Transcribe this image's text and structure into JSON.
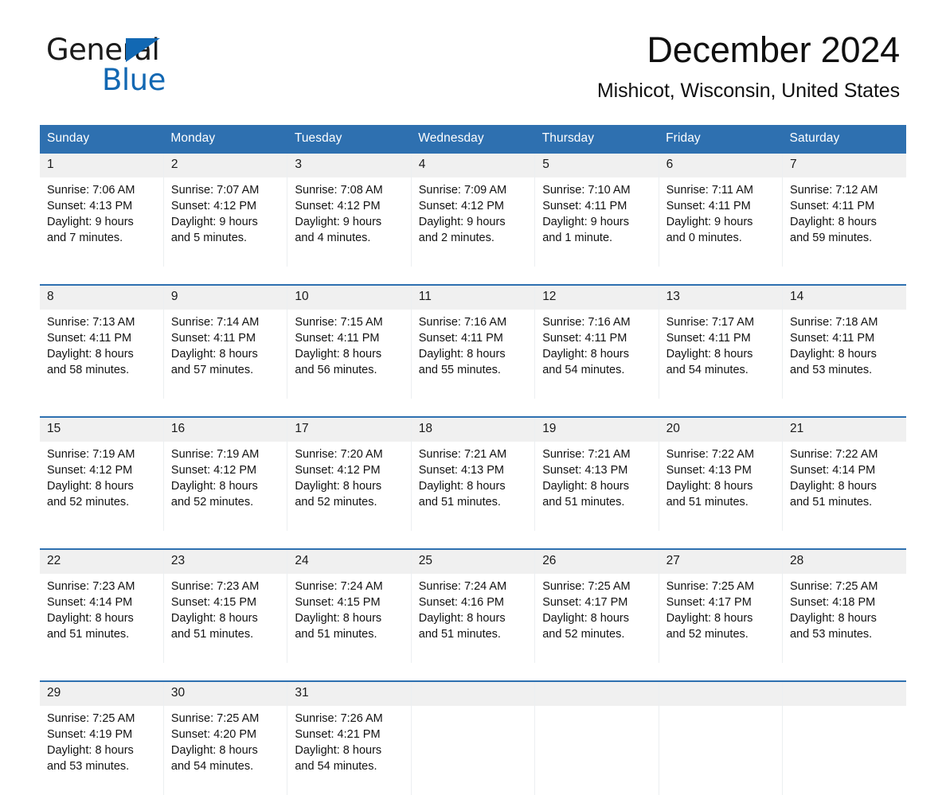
{
  "brand": {
    "name_part1": "General",
    "name_part2": "Blue",
    "accent_color": "#1268b3"
  },
  "header": {
    "title": "December 2024",
    "subtitle": "Mishicot, Wisconsin, United States"
  },
  "theme": {
    "header_blue": "#2e70b0",
    "daynum_band": "#f0f0f0",
    "text": "#1a1a1a"
  },
  "weekday_headers": [
    "Sunday",
    "Monday",
    "Tuesday",
    "Wednesday",
    "Thursday",
    "Friday",
    "Saturday"
  ],
  "labels": {
    "sunrise_prefix": "Sunrise:",
    "sunset_prefix": "Sunset:",
    "daylight_prefix": "Daylight:"
  },
  "weeks": [
    [
      {
        "day": "1",
        "sunrise": "Sunrise: 7:06 AM",
        "sunset": "Sunset: 4:13 PM",
        "daylight_line1": "Daylight: 9 hours",
        "daylight_line2": "and 7 minutes."
      },
      {
        "day": "2",
        "sunrise": "Sunrise: 7:07 AM",
        "sunset": "Sunset: 4:12 PM",
        "daylight_line1": "Daylight: 9 hours",
        "daylight_line2": "and 5 minutes."
      },
      {
        "day": "3",
        "sunrise": "Sunrise: 7:08 AM",
        "sunset": "Sunset: 4:12 PM",
        "daylight_line1": "Daylight: 9 hours",
        "daylight_line2": "and 4 minutes."
      },
      {
        "day": "4",
        "sunrise": "Sunrise: 7:09 AM",
        "sunset": "Sunset: 4:12 PM",
        "daylight_line1": "Daylight: 9 hours",
        "daylight_line2": "and 2 minutes."
      },
      {
        "day": "5",
        "sunrise": "Sunrise: 7:10 AM",
        "sunset": "Sunset: 4:11 PM",
        "daylight_line1": "Daylight: 9 hours",
        "daylight_line2": "and 1 minute."
      },
      {
        "day": "6",
        "sunrise": "Sunrise: 7:11 AM",
        "sunset": "Sunset: 4:11 PM",
        "daylight_line1": "Daylight: 9 hours",
        "daylight_line2": "and 0 minutes."
      },
      {
        "day": "7",
        "sunrise": "Sunrise: 7:12 AM",
        "sunset": "Sunset: 4:11 PM",
        "daylight_line1": "Daylight: 8 hours",
        "daylight_line2": "and 59 minutes."
      }
    ],
    [
      {
        "day": "8",
        "sunrise": "Sunrise: 7:13 AM",
        "sunset": "Sunset: 4:11 PM",
        "daylight_line1": "Daylight: 8 hours",
        "daylight_line2": "and 58 minutes."
      },
      {
        "day": "9",
        "sunrise": "Sunrise: 7:14 AM",
        "sunset": "Sunset: 4:11 PM",
        "daylight_line1": "Daylight: 8 hours",
        "daylight_line2": "and 57 minutes."
      },
      {
        "day": "10",
        "sunrise": "Sunrise: 7:15 AM",
        "sunset": "Sunset: 4:11 PM",
        "daylight_line1": "Daylight: 8 hours",
        "daylight_line2": "and 56 minutes."
      },
      {
        "day": "11",
        "sunrise": "Sunrise: 7:16 AM",
        "sunset": "Sunset: 4:11 PM",
        "daylight_line1": "Daylight: 8 hours",
        "daylight_line2": "and 55 minutes."
      },
      {
        "day": "12",
        "sunrise": "Sunrise: 7:16 AM",
        "sunset": "Sunset: 4:11 PM",
        "daylight_line1": "Daylight: 8 hours",
        "daylight_line2": "and 54 minutes."
      },
      {
        "day": "13",
        "sunrise": "Sunrise: 7:17 AM",
        "sunset": "Sunset: 4:11 PM",
        "daylight_line1": "Daylight: 8 hours",
        "daylight_line2": "and 54 minutes."
      },
      {
        "day": "14",
        "sunrise": "Sunrise: 7:18 AM",
        "sunset": "Sunset: 4:11 PM",
        "daylight_line1": "Daylight: 8 hours",
        "daylight_line2": "and 53 minutes."
      }
    ],
    [
      {
        "day": "15",
        "sunrise": "Sunrise: 7:19 AM",
        "sunset": "Sunset: 4:12 PM",
        "daylight_line1": "Daylight: 8 hours",
        "daylight_line2": "and 52 minutes."
      },
      {
        "day": "16",
        "sunrise": "Sunrise: 7:19 AM",
        "sunset": "Sunset: 4:12 PM",
        "daylight_line1": "Daylight: 8 hours",
        "daylight_line2": "and 52 minutes."
      },
      {
        "day": "17",
        "sunrise": "Sunrise: 7:20 AM",
        "sunset": "Sunset: 4:12 PM",
        "daylight_line1": "Daylight: 8 hours",
        "daylight_line2": "and 52 minutes."
      },
      {
        "day": "18",
        "sunrise": "Sunrise: 7:21 AM",
        "sunset": "Sunset: 4:13 PM",
        "daylight_line1": "Daylight: 8 hours",
        "daylight_line2": "and 51 minutes."
      },
      {
        "day": "19",
        "sunrise": "Sunrise: 7:21 AM",
        "sunset": "Sunset: 4:13 PM",
        "daylight_line1": "Daylight: 8 hours",
        "daylight_line2": "and 51 minutes."
      },
      {
        "day": "20",
        "sunrise": "Sunrise: 7:22 AM",
        "sunset": "Sunset: 4:13 PM",
        "daylight_line1": "Daylight: 8 hours",
        "daylight_line2": "and 51 minutes."
      },
      {
        "day": "21",
        "sunrise": "Sunrise: 7:22 AM",
        "sunset": "Sunset: 4:14 PM",
        "daylight_line1": "Daylight: 8 hours",
        "daylight_line2": "and 51 minutes."
      }
    ],
    [
      {
        "day": "22",
        "sunrise": "Sunrise: 7:23 AM",
        "sunset": "Sunset: 4:14 PM",
        "daylight_line1": "Daylight: 8 hours",
        "daylight_line2": "and 51 minutes."
      },
      {
        "day": "23",
        "sunrise": "Sunrise: 7:23 AM",
        "sunset": "Sunset: 4:15 PM",
        "daylight_line1": "Daylight: 8 hours",
        "daylight_line2": "and 51 minutes."
      },
      {
        "day": "24",
        "sunrise": "Sunrise: 7:24 AM",
        "sunset": "Sunset: 4:15 PM",
        "daylight_line1": "Daylight: 8 hours",
        "daylight_line2": "and 51 minutes."
      },
      {
        "day": "25",
        "sunrise": "Sunrise: 7:24 AM",
        "sunset": "Sunset: 4:16 PM",
        "daylight_line1": "Daylight: 8 hours",
        "daylight_line2": "and 51 minutes."
      },
      {
        "day": "26",
        "sunrise": "Sunrise: 7:25 AM",
        "sunset": "Sunset: 4:17 PM",
        "daylight_line1": "Daylight: 8 hours",
        "daylight_line2": "and 52 minutes."
      },
      {
        "day": "27",
        "sunrise": "Sunrise: 7:25 AM",
        "sunset": "Sunset: 4:17 PM",
        "daylight_line1": "Daylight: 8 hours",
        "daylight_line2": "and 52 minutes."
      },
      {
        "day": "28",
        "sunrise": "Sunrise: 7:25 AM",
        "sunset": "Sunset: 4:18 PM",
        "daylight_line1": "Daylight: 8 hours",
        "daylight_line2": "and 53 minutes."
      }
    ],
    [
      {
        "day": "29",
        "sunrise": "Sunrise: 7:25 AM",
        "sunset": "Sunset: 4:19 PM",
        "daylight_line1": "Daylight: 8 hours",
        "daylight_line2": "and 53 minutes."
      },
      {
        "day": "30",
        "sunrise": "Sunrise: 7:25 AM",
        "sunset": "Sunset: 4:20 PM",
        "daylight_line1": "Daylight: 8 hours",
        "daylight_line2": "and 54 minutes."
      },
      {
        "day": "31",
        "sunrise": "Sunrise: 7:26 AM",
        "sunset": "Sunset: 4:21 PM",
        "daylight_line1": "Daylight: 8 hours",
        "daylight_line2": "and 54 minutes."
      },
      {
        "day": "",
        "sunrise": "",
        "sunset": "",
        "daylight_line1": "",
        "daylight_line2": ""
      },
      {
        "day": "",
        "sunrise": "",
        "sunset": "",
        "daylight_line1": "",
        "daylight_line2": ""
      },
      {
        "day": "",
        "sunrise": "",
        "sunset": "",
        "daylight_line1": "",
        "daylight_line2": ""
      },
      {
        "day": "",
        "sunrise": "",
        "sunset": "",
        "daylight_line1": "",
        "daylight_line2": ""
      }
    ]
  ]
}
